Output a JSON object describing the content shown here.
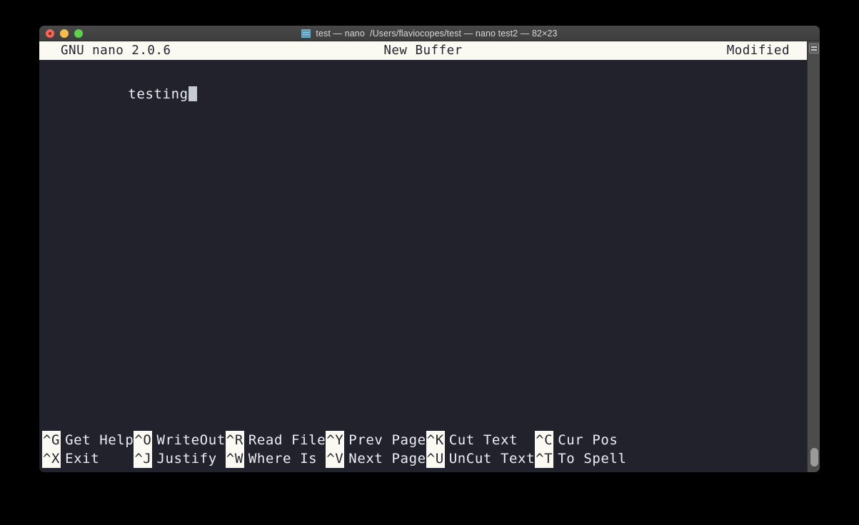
{
  "window": {
    "title": "test — nano  /Users/flaviocopes/test — nano test2 — 82×23",
    "app_icon": "terminal-icon",
    "controls": {
      "close": "close-button",
      "minimize": "minimize-button",
      "zoom": "zoom-button"
    }
  },
  "nano": {
    "version": "GNU nano 2.0.6",
    "buffer": "New Buffer",
    "status": "Modified",
    "content": "testing",
    "cursor": "block-cursor"
  },
  "help": [
    {
      "key": "^G",
      "label": "Get Help",
      "key2": "^X",
      "label2": "Exit"
    },
    {
      "key": "^O",
      "label": "WriteOut",
      "key2": "^J",
      "label2": "Justify"
    },
    {
      "key": "^R",
      "label": "Read File",
      "key2": "^W",
      "label2": "Where Is"
    },
    {
      "key": "^Y",
      "label": "Prev Page",
      "key2": "^V",
      "label2": "Next Page"
    },
    {
      "key": "^K",
      "label": "Cut Text",
      "key2": "^U",
      "label2": "UnCut Text"
    },
    {
      "key": "^C",
      "label": "Cur Pos",
      "key2": "^T",
      "label2": "To Spell"
    }
  ],
  "colors": {
    "terminal_bg": "#22222c",
    "status_bg": "#faf9f2",
    "status_fg": "#25252f",
    "text_fg": "#eceff4",
    "titlebar_bg": "#444444",
    "scrollbar_bg": "#4c4c4c"
  }
}
